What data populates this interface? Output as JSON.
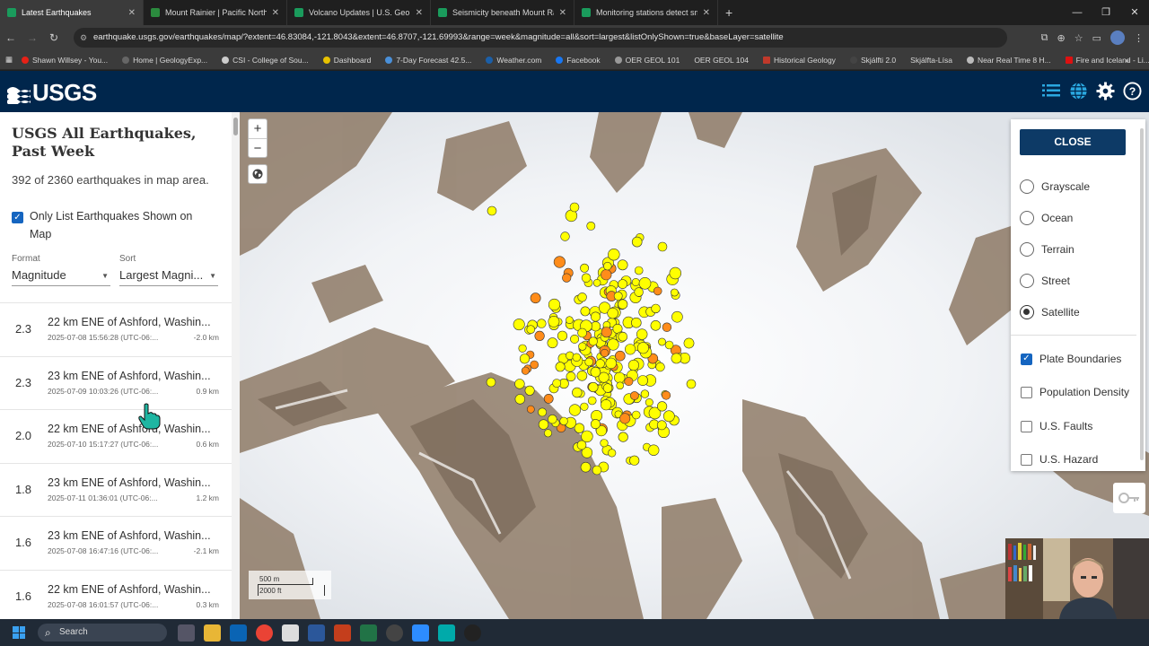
{
  "browser": {
    "tabs": [
      {
        "title": "Latest Earthquakes",
        "active": true
      },
      {
        "title": "Mount Rainier | Pacific Northwe",
        "active": false
      },
      {
        "title": "Volcano Updates | U.S. Geologi",
        "active": false
      },
      {
        "title": "Seismicity beneath Mount Raini",
        "active": false
      },
      {
        "title": "Monitoring stations detect sma",
        "active": false
      }
    ],
    "url": "earthquake.usgs.gov/earthquakes/map/?extent=46.83084,-121.8043&extent=46.8707,-121.69993&range=week&magnitude=all&sort=largest&listOnlyShown=true&baseLayer=satellite",
    "bookmarks": [
      "Shawn Willsey - You...",
      "Home | GeologyExp...",
      "CSI - College of Sou...",
      "Dashboard",
      "7-Day Forecast 42.5...",
      "Weather.com",
      "Facebook",
      "OER GEOL 101",
      "OER GEOL 104",
      "Historical Geology",
      "Skjálfti 2.0",
      "Skjálfta-Lísa",
      "Near Real Time 8 H...",
      "Fire and Iceland - Li..."
    ]
  },
  "header": {
    "logo_text": "USGS",
    "icons": [
      "list-icon",
      "globe-icon",
      "gear-icon",
      "help-icon"
    ]
  },
  "sidebar": {
    "title": "USGS All Earthquakes, Past Week",
    "count_text": "392 of 2360 earthquakes in map area.",
    "only_list_label": "Only List Earthquakes Shown on Map",
    "only_list_checked": true,
    "format_label": "Format",
    "format_value": "Magnitude",
    "sort_label": "Sort",
    "sort_value": "Largest Magni..."
  },
  "earthquakes": [
    {
      "mag": "2.3",
      "place": "22 km ENE of Ashford, Washin...",
      "time": "2025-07-08 15:56:28 (UTC-06:...",
      "depth": "-2.0 km"
    },
    {
      "mag": "2.3",
      "place": "23 km ENE of Ashford, Washin...",
      "time": "2025-07-09 10:03:26 (UTC-06:...",
      "depth": "0.9 km"
    },
    {
      "mag": "2.0",
      "place": "22 km ENE of Ashford, Washin...",
      "time": "2025-07-10 15:17:27 (UTC-06:...",
      "depth": "0.6 km"
    },
    {
      "mag": "1.8",
      "place": "23 km ENE of Ashford, Washin...",
      "time": "2025-07-11 01:36:01 (UTC-06:...",
      "depth": "1.2 km"
    },
    {
      "mag": "1.6",
      "place": "23 km ENE of Ashford, Washin...",
      "time": "2025-07-08 16:47:16 (UTC-06:...",
      "depth": "-2.1 km"
    },
    {
      "mag": "1.6",
      "place": "22 km ENE of Ashford, Washin...",
      "time": "2025-07-08 16:01:57 (UTC-06:...",
      "depth": "0.3 km"
    }
  ],
  "map": {
    "zoom_in": "+",
    "zoom_out": "−",
    "scale_metric": "500 m",
    "scale_imperial": "2000 ft",
    "colors": {
      "recent": "#ffff00",
      "older": "#ff8c1a",
      "outline": "#333333"
    }
  },
  "basemap_panel": {
    "close_label": "CLOSE",
    "basemaps": [
      {
        "label": "Grayscale",
        "selected": false
      },
      {
        "label": "Ocean",
        "selected": false
      },
      {
        "label": "Terrain",
        "selected": false
      },
      {
        "label": "Street",
        "selected": false
      },
      {
        "label": "Satellite",
        "selected": true
      }
    ],
    "overlays": [
      {
        "label": "Plate Boundaries",
        "checked": true
      },
      {
        "label": "Population Density",
        "checked": false
      },
      {
        "label": "U.S. Faults",
        "checked": false
      },
      {
        "label": "U.S. Hazard",
        "checked": false
      }
    ]
  },
  "taskbar": {
    "search_placeholder": "Search"
  }
}
